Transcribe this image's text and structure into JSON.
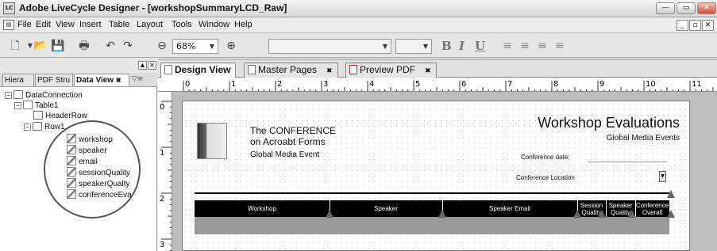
{
  "window": {
    "title": "Adobe LiveCycle Designer - [workshopSummaryLCD_Raw]",
    "logo": "LC"
  },
  "menu": {
    "items": [
      "File",
      "Edit",
      "View",
      "Insert",
      "Table",
      "Layout",
      "Tools",
      "Window",
      "Help"
    ]
  },
  "toolbar": {
    "zoom": "68%",
    "font_family": "",
    "font_size": ""
  },
  "left_panel": {
    "tabs": [
      "Hiera",
      "PDF Stru",
      "Data View"
    ],
    "tree": {
      "root": "DataConnection",
      "table": "Table1",
      "header_row": "HeaderRow",
      "row": "Row1",
      "fields": [
        "workshop",
        "speaker",
        "email",
        "sessionQuality",
        "speakerQualty",
        "conferenceEva"
      ]
    }
  },
  "doc_tabs": [
    "Design View",
    "Master Pages",
    "Preview PDF"
  ],
  "ruler": {
    "h_marks": [
      "0",
      "1",
      "2",
      "3",
      "4",
      "5",
      "6",
      "7",
      "8",
      "9",
      "10",
      "11"
    ],
    "v_marks": [
      "0",
      "1",
      "2",
      "3"
    ]
  },
  "form": {
    "conference_line1": "The CONFERENCE",
    "conference_line2": "on Acroabt Forms",
    "event_name": "Global Media Event",
    "title": "Workshop Evaluations",
    "subtitle": "Global Media Events",
    "date_label": "Conference date:",
    "location_label": "Conference Location",
    "columns": [
      "Workshop",
      "Speaker",
      "Speaker Email",
      "Session Quality",
      "Speaker Quality",
      "Conference Overall"
    ]
  }
}
